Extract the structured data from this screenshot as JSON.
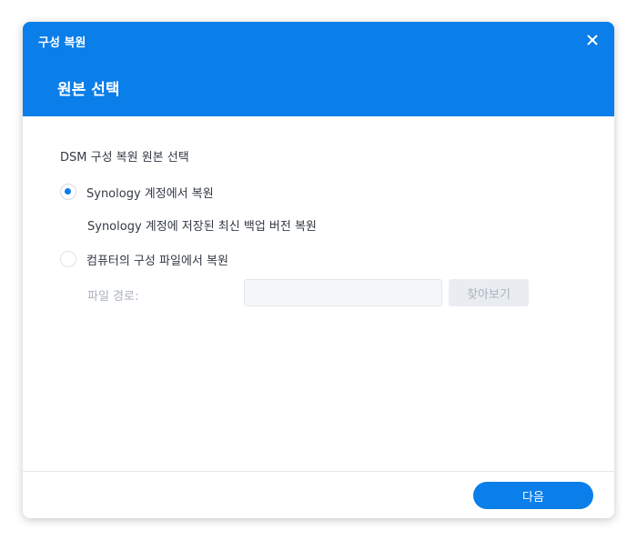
{
  "dialog": {
    "title": "구성 복원",
    "page_title": "원본 선택",
    "close_icon": "close-icon"
  },
  "content": {
    "section_title": "DSM 구성 복원 원본 선택",
    "options": [
      {
        "label": "Synology 계정에서 복원",
        "selected": true
      },
      {
        "label": "컴퓨터의 구성 파일에서 복원",
        "selected": false
      }
    ],
    "option1_description": "Synology 계정에 저장된 최신 백업 버전 복원",
    "file_path": {
      "label": "파일 경로:",
      "value": "",
      "browse_label": "찾아보기"
    }
  },
  "footer": {
    "next_label": "다음"
  },
  "colors": {
    "accent": "#0a7ee9",
    "text": "#333a44",
    "disabled_text": "#aab2bd"
  }
}
